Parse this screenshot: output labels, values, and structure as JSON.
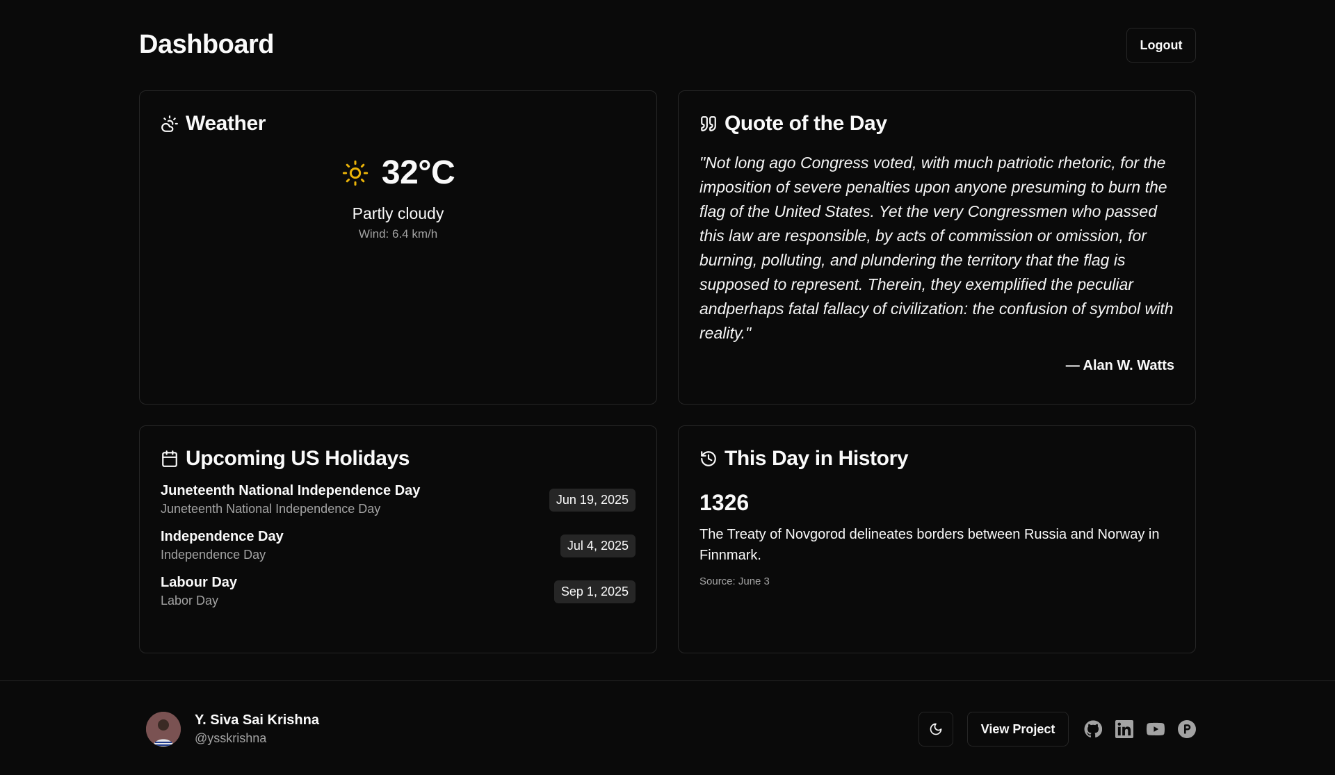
{
  "header": {
    "title": "Dashboard",
    "logout_label": "Logout"
  },
  "weather": {
    "title": "Weather",
    "temperature": "32°C",
    "condition": "Partly cloudy",
    "wind": "Wind: 6.4 km/h",
    "sun_color": "#eab308"
  },
  "quote": {
    "title": "Quote of the Day",
    "text": "\"Not long ago Congress voted, with much patriotic rhetoric, for the imposition of severe penalties upon anyone presuming to burn the flag of the United States. Yet the very Congressmen who passed this law are responsible, by acts of commission or omission, for burning, polluting, and plundering the territory that the flag is supposed to represent. Therein, they exemplified the peculiar andperhaps fatal fallacy of civilization: the confusion of symbol with reality.\"",
    "author": "— Alan W. Watts"
  },
  "holidays": {
    "title": "Upcoming US Holidays",
    "items": [
      {
        "name": "Juneteenth National Independence Day",
        "local": "Juneteenth National Independence Day",
        "date": "Jun 19, 2025"
      },
      {
        "name": "Independence Day",
        "local": "Independence Day",
        "date": "Jul 4, 2025"
      },
      {
        "name": "Labour Day",
        "local": "Labor Day",
        "date": "Sep 1, 2025"
      }
    ]
  },
  "history": {
    "title": "This Day in History",
    "year": "1326",
    "event": "The Treaty of Novgorod delineates borders between Russia and Norway in Finnmark.",
    "source": "Source: June 3"
  },
  "footer": {
    "user_name": "Y. Siva Sai Krishna",
    "user_handle": "@ysskrishna",
    "view_project_label": "View Project",
    "icons": [
      "moon-icon",
      "github-icon",
      "linkedin-icon",
      "youtube-icon",
      "producthunt-icon"
    ]
  }
}
